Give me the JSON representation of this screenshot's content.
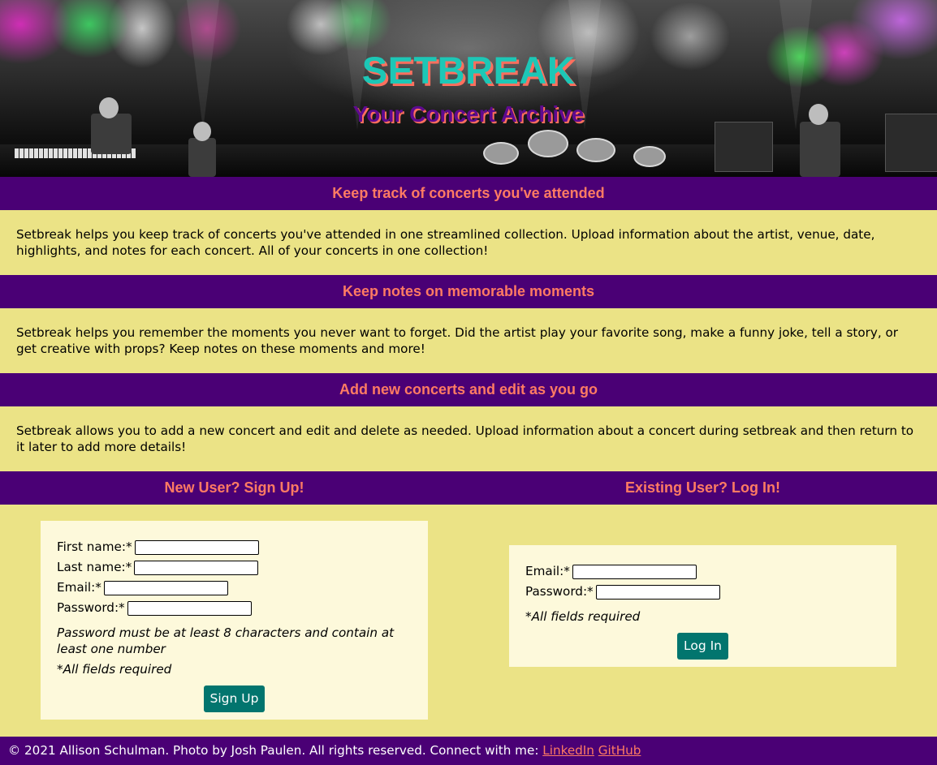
{
  "header": {
    "title": "SETBREAK",
    "subtitle": "Your Concert Archive"
  },
  "features": [
    {
      "heading": "Keep track of concerts you've attended",
      "text": "Setbreak helps you keep track of concerts you've attended in one streamlined collection. Upload information about the artist, venue, date, highlights, and notes for each concert. All of your concerts in one collection!"
    },
    {
      "heading": "Keep notes on memorable moments",
      "text": "Setbreak helps you remember the moments you never want to forget. Did the artist play your favorite song, make a funny joke, tell a story, or get creative with props? Keep notes on these moments and more!"
    },
    {
      "heading": "Add new concerts and edit as you go",
      "text": "Setbreak allows you to add a new concert and edit and delete as needed. Upload information about a concert during setbreak and then return to it later to add more details!"
    }
  ],
  "signup": {
    "heading": "New User? Sign Up!",
    "first_name_label": "First name:*",
    "first_name_value": "",
    "last_name_label": "Last name:*",
    "last_name_value": "",
    "email_label": "Email:*",
    "email_value": "",
    "password_label": "Password:*",
    "password_value": "",
    "password_hint": "Password must be at least 8 characters and contain at least one number",
    "required_note": "*All fields required",
    "button_label": "Sign Up"
  },
  "login": {
    "heading": "Existing User? Log In!",
    "email_label": "Email:*",
    "email_value": "",
    "password_label": "Password:*",
    "password_value": "",
    "required_note": "*All fields required",
    "button_label": "Log In"
  },
  "footer": {
    "text": "© 2021 Allison Schulman. Photo by Josh Paulen. All rights reserved. Connect with me:",
    "linkedin_label": "LinkedIn",
    "github_label": "GitHub"
  },
  "colors": {
    "accent_purple": "#4a0075",
    "heading_coral": "#ff7b63",
    "background_yellow": "#ebe386",
    "form_background": "#fdf9db",
    "button_teal": "#02756e",
    "title_teal": "#1dc7b6"
  }
}
